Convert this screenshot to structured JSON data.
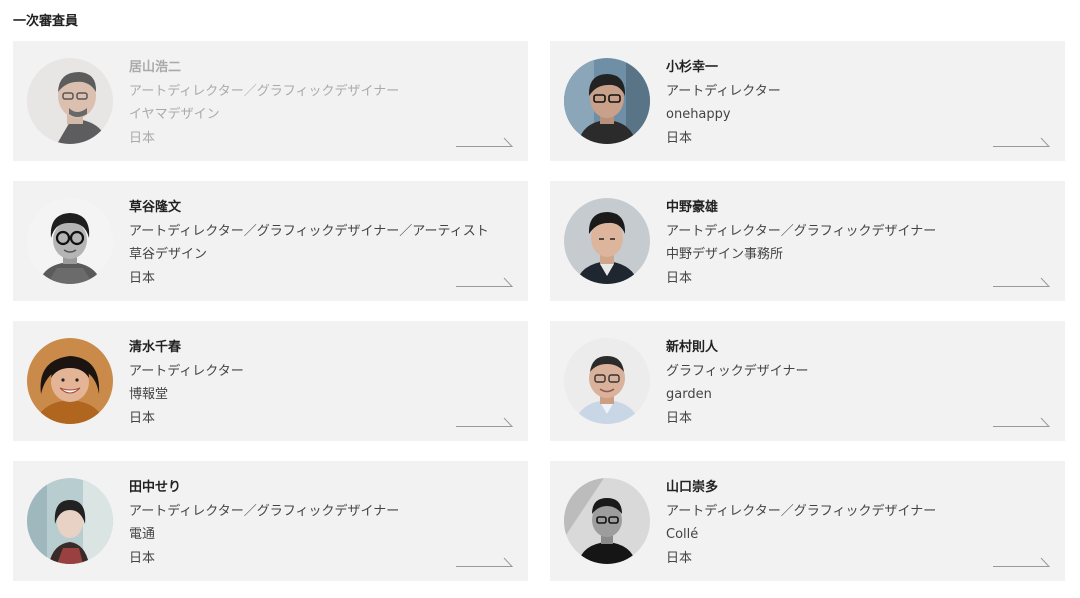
{
  "section": {
    "title": "一次審査員"
  },
  "jurors": [
    {
      "name": "居山浩二",
      "role": "アートディレクター／グラフィックデザイナー",
      "company": "イヤマデザイン",
      "country": "日本"
    },
    {
      "name": "小杉幸一",
      "role": "アートディレクター",
      "company": "onehappy",
      "country": "日本"
    },
    {
      "name": "草谷隆文",
      "role": "アートディレクター／グラフィックデザイナー／アーティスト",
      "company": "草谷デザイン",
      "country": "日本"
    },
    {
      "name": "中野豪雄",
      "role": "アートディレクター／グラフィックデザイナー",
      "company": "中野デザイン事務所",
      "country": "日本"
    },
    {
      "name": "清水千春",
      "role": "アートディレクター",
      "company": "博報堂",
      "country": "日本"
    },
    {
      "name": "新村則人",
      "role": "グラフィックデザイナー",
      "company": "garden",
      "country": "日本"
    },
    {
      "name": "田中せり",
      "role": "アートディレクター／グラフィックデザイナー",
      "company": "電通",
      "country": "日本"
    },
    {
      "name": "山口崇多",
      "role": "アートディレクター／グラフィックデザイナー",
      "company": "Collé",
      "country": "日本"
    }
  ],
  "colors": {
    "card_background": "#f2f2f2",
    "text_primary": "#222222",
    "text_faded": "#aaaaaa",
    "arrow": "#999999"
  },
  "icons": {
    "card_link": "long-arrow-right-icon"
  }
}
